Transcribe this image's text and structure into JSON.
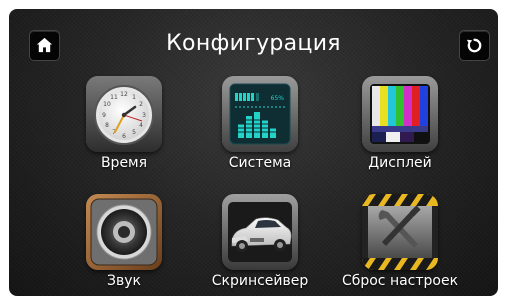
{
  "title": "Конфигурация",
  "topbar": {
    "home_icon": "home-icon",
    "reset_icon": "reset-icon"
  },
  "items": [
    {
      "label": "Время",
      "icon": "clock-icon"
    },
    {
      "label": "Система",
      "icon": "system-meter-icon",
      "meter_text": "65%"
    },
    {
      "label": "Дисплей",
      "icon": "color-bars-icon"
    },
    {
      "label": "Звук",
      "icon": "speaker-icon"
    },
    {
      "label": "Скринсейвер",
      "icon": "car-icon"
    },
    {
      "label": "Сброс настроек",
      "icon": "tools-icon"
    }
  ]
}
